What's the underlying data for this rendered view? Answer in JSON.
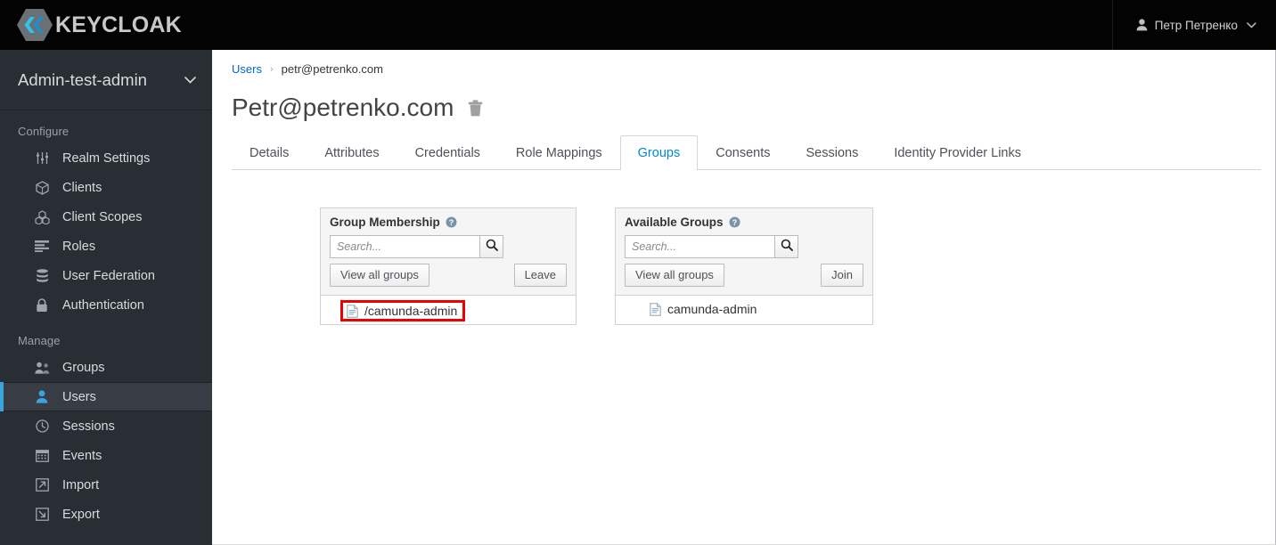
{
  "masthead": {
    "brand_text": "KEYCLOAK",
    "logo_icon": "keycloak-logo-icon",
    "user": {
      "name": "Петр Петренко",
      "avatar_icon": "user-icon",
      "caret_icon": "chevron-down-icon"
    }
  },
  "sidebar": {
    "realm": {
      "name": "Admin-test-admin",
      "caret_icon": "chevron-down-icon"
    },
    "sections": [
      {
        "label": "Configure",
        "items": [
          {
            "label": "Realm Settings",
            "icon": "sliders-icon",
            "active": false
          },
          {
            "label": "Clients",
            "icon": "cube-icon",
            "active": false
          },
          {
            "label": "Client Scopes",
            "icon": "cubes-icon",
            "active": false
          },
          {
            "label": "Roles",
            "icon": "list-bars-icon",
            "active": false
          },
          {
            "label": "User Federation",
            "icon": "database-icon",
            "active": false
          },
          {
            "label": "Authentication",
            "icon": "lock-icon",
            "active": false
          }
        ]
      },
      {
        "label": "Manage",
        "items": [
          {
            "label": "Groups",
            "icon": "users-group-icon",
            "active": false
          },
          {
            "label": "Users",
            "icon": "user-icon",
            "active": true
          },
          {
            "label": "Sessions",
            "icon": "clock-icon",
            "active": false
          },
          {
            "label": "Events",
            "icon": "calendar-icon",
            "active": false
          },
          {
            "label": "Import",
            "icon": "import-arrow-icon",
            "active": false
          },
          {
            "label": "Export",
            "icon": "export-arrow-icon",
            "active": false
          }
        ]
      }
    ]
  },
  "main": {
    "breadcrumb": {
      "root": "Users",
      "separator": "›",
      "current": "petr@petrenko.com"
    },
    "page_title": "Petr@petrenko.com",
    "delete_icon": "trash-icon",
    "tabs": [
      {
        "label": "Details",
        "active": false
      },
      {
        "label": "Attributes",
        "active": false
      },
      {
        "label": "Credentials",
        "active": false
      },
      {
        "label": "Role Mappings",
        "active": false
      },
      {
        "label": "Groups",
        "active": true
      },
      {
        "label": "Consents",
        "active": false
      },
      {
        "label": "Sessions",
        "active": false
      },
      {
        "label": "Identity Provider Links",
        "active": false
      }
    ],
    "group_membership": {
      "title": "Group Membership",
      "help_icon": "help-circle-icon",
      "search_placeholder": "Search...",
      "search_value": "",
      "search_icon": "search-icon",
      "view_all_label": "View all groups",
      "action_label": "Leave",
      "rows": [
        {
          "label": "/camunda-admin",
          "icon": "document-icon",
          "highlighted": true
        }
      ]
    },
    "available_groups": {
      "title": "Available Groups",
      "help_icon": "help-circle-icon",
      "search_placeholder": "Search...",
      "search_value": "",
      "search_icon": "search-icon",
      "view_all_label": "View all groups",
      "action_label": "Join",
      "rows": [
        {
          "label": "camunda-admin",
          "icon": "document-icon",
          "highlighted": false
        }
      ]
    }
  },
  "colors": {
    "masthead_bg": "#030303",
    "sidebar_bg": "#292e34",
    "sidebar_active_bg": "#383d45",
    "accent_blue": "#39a5dc",
    "link_blue": "#0066cc",
    "tab_active": "#0088ce",
    "highlight_red": "#ee0000"
  }
}
